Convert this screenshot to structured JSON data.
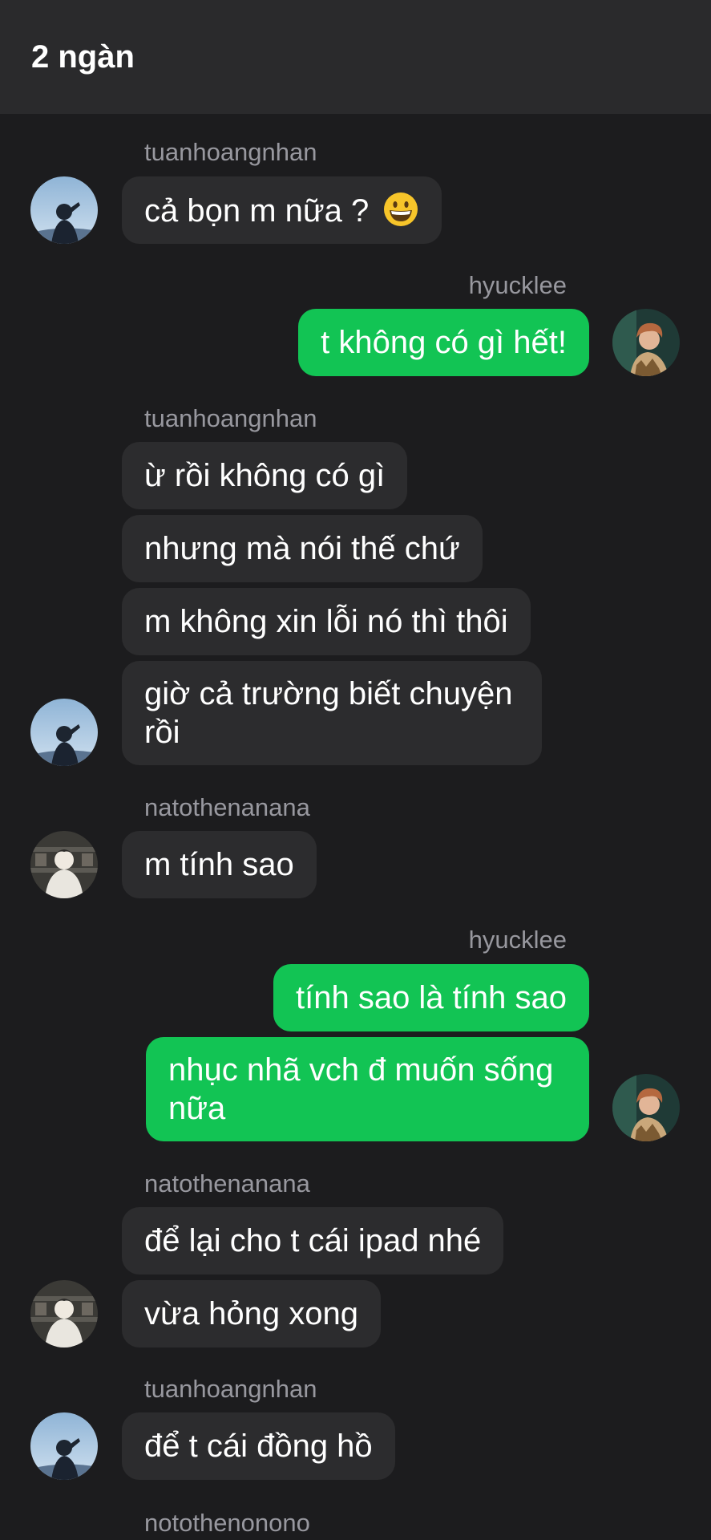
{
  "header": {
    "title": "2 ngàn"
  },
  "groups": [
    {
      "sender": "tuanhoangnhan",
      "messages": [
        "cả bọn m nữa ?"
      ],
      "emoji": "grinning-face-emoji"
    },
    {
      "sender": "hyucklee",
      "messages": [
        "t không có gì hết!"
      ]
    },
    {
      "sender": "tuanhoangnhan",
      "messages": [
        "ừ rồi không có gì",
        "nhưng mà nói thế chứ",
        "m không xin lỗi nó thì thôi",
        "giờ cả trường biết chuyện rồi"
      ]
    },
    {
      "sender": "natothenanana",
      "messages": [
        "m tính sao"
      ]
    },
    {
      "sender": "hyucklee",
      "messages": [
        "tính sao là tính sao",
        "nhục nhã vch đ muốn sống nữa"
      ]
    },
    {
      "sender": "natothenanana",
      "messages": [
        "để lại cho t cái ipad nhé",
        "vừa hỏng xong"
      ]
    },
    {
      "sender": "tuanhoangnhan",
      "messages": [
        "để t cái đồng hồ"
      ]
    },
    {
      "sender": "notothenonono",
      "messages": []
    }
  ],
  "colors": {
    "background": "#1c1c1e",
    "header": "#2a2a2c",
    "incoming_bubble": "#2c2c2e",
    "outgoing_bubble": "#12c454",
    "username": "#98989f"
  }
}
